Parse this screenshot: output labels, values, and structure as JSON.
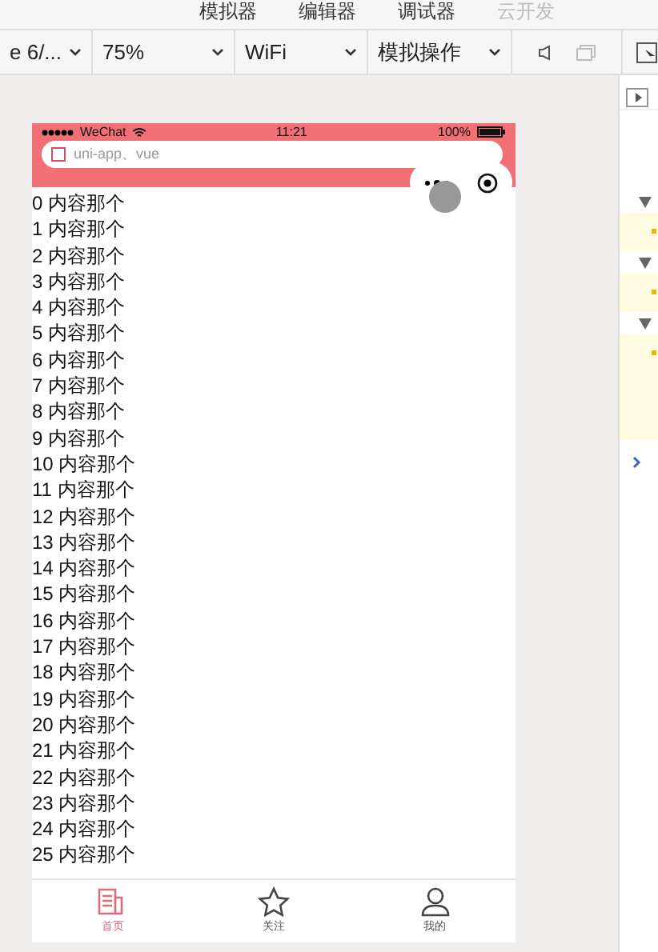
{
  "top_tabs": [
    {
      "label": "模拟器",
      "disabled": false
    },
    {
      "label": "编辑器",
      "disabled": false
    },
    {
      "label": "调试器",
      "disabled": false
    },
    {
      "label": "云开发",
      "disabled": true
    }
  ],
  "toolbar": {
    "dropdowns": [
      "e 6/...",
      "75%",
      "WiFi",
      "模拟操作"
    ]
  },
  "phone": {
    "status_bar": {
      "carrier": "WeChat",
      "time": "11:21",
      "battery": "100%",
      "level": 1
    },
    "search": {
      "placeholder": "uni-app、vue"
    },
    "list": [
      "0 内容那个",
      "1 内容那个",
      "2 内容那个",
      "3 内容那个",
      "4 内容那个",
      "5 内容那个",
      "6 内容那个",
      "7 内容那个",
      "8 内容那个",
      "9 内容那个",
      "10 内容那个",
      "11 内容那个",
      "12 内容那个",
      "13 内容那个",
      "14 内容那个",
      "15 内容那个",
      "16 内容那个",
      "17 内容那个",
      "18 内容那个",
      "19 内容那个",
      "20 内容那个",
      "21 内容那个",
      "22 内容那个",
      "23 内容那个",
      "24 内容那个",
      "25 内容那个"
    ],
    "tab_bar": [
      {
        "label": "首页",
        "selected": true
      },
      {
        "label": "关注",
        "selected": false
      },
      {
        "label": "我的",
        "selected": false
      }
    ]
  },
  "devtools": {
    "groups": [
      {
        "expanded": true
      },
      {
        "expanded": true
      },
      {
        "expanded": true
      }
    ]
  }
}
